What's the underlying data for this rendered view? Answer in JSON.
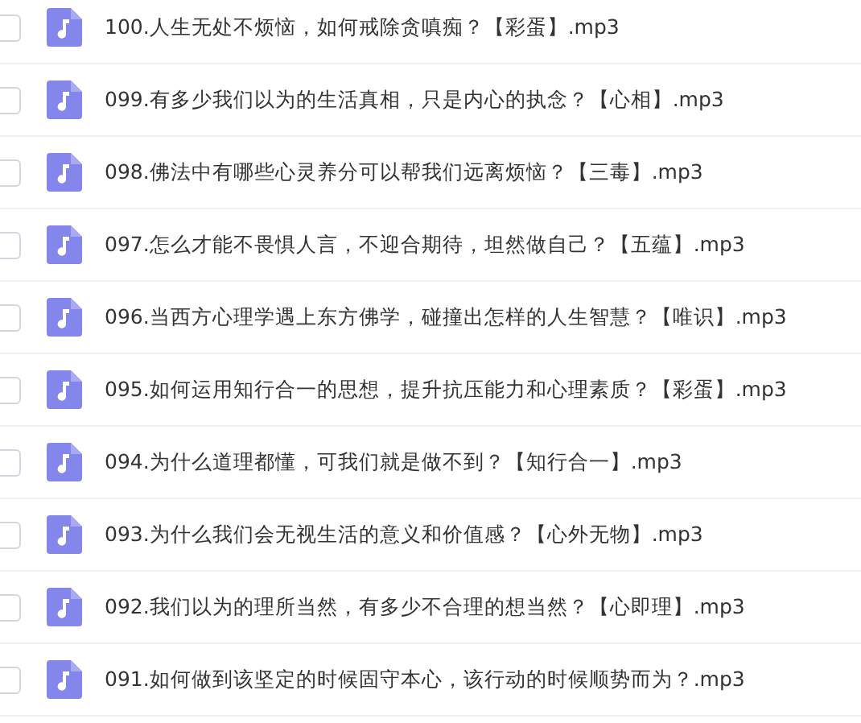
{
  "files": [
    {
      "name": "100.人生无处不烦恼，如何戒除贪嗔痴？【彩蛋】.mp3",
      "checked": false
    },
    {
      "name": "099.有多少我们以为的生活真相，只是内心的执念？【心相】.mp3",
      "checked": false
    },
    {
      "name": "098.佛法中有哪些心灵养分可以帮我们远离烦恼？【三毒】.mp3",
      "checked": false
    },
    {
      "name": "097.怎么才能不畏惧人言，不迎合期待，坦然做自己？【五蕴】.mp3",
      "checked": false
    },
    {
      "name": "096.当西方心理学遇上东方佛学，碰撞出怎样的人生智慧？【唯识】.mp3",
      "checked": false
    },
    {
      "name": "095.如何运用知行合一的思想，提升抗压能力和心理素质？【彩蛋】.mp3",
      "checked": false
    },
    {
      "name": "094.为什么道理都懂，可我们就是做不到？【知行合一】.mp3",
      "checked": false
    },
    {
      "name": "093.为什么我们会无视生活的意义和价值感？【心外无物】.mp3",
      "checked": false
    },
    {
      "name": "092.我们以为的理所当然，有多少不合理的想当然？【心即理】.mp3",
      "checked": false
    },
    {
      "name": "091.如何做到该坚定的时候固守本心，该行动的时候顺势而为？.mp3",
      "checked": false
    }
  ]
}
